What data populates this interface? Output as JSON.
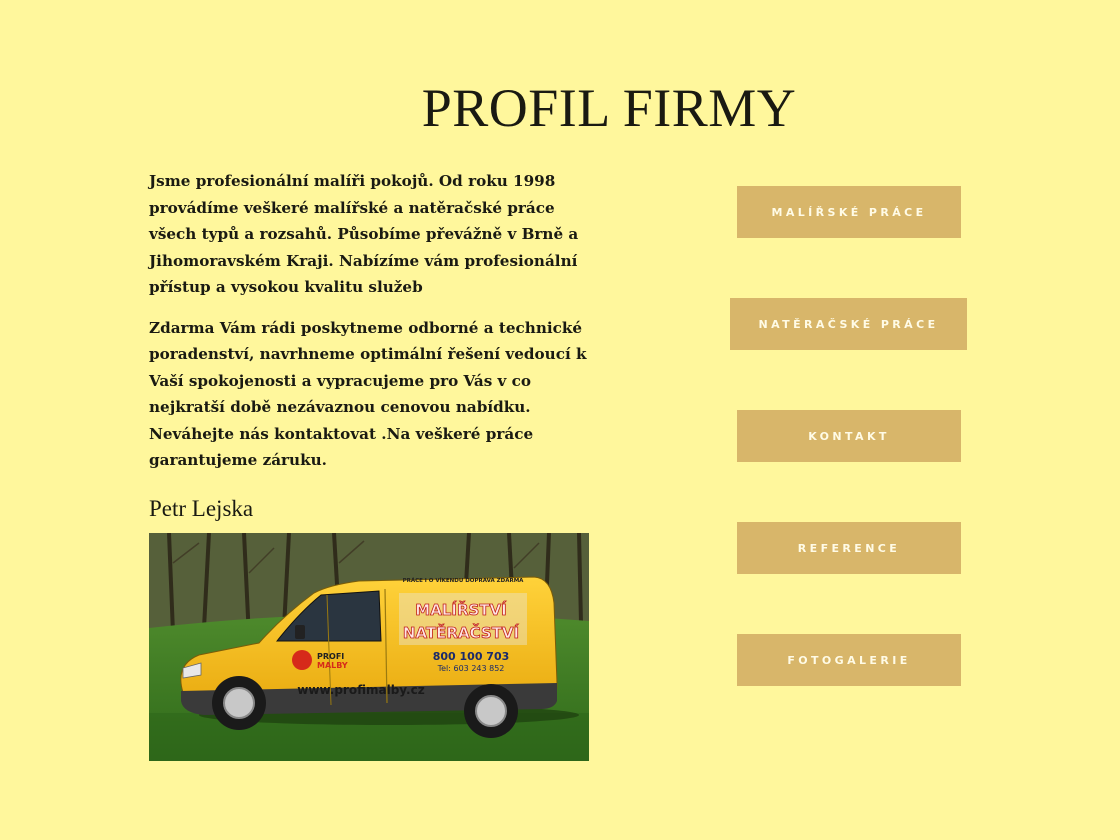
{
  "page": {
    "title": "PROFIL FIRMY"
  },
  "intro": {
    "paragraph1": "Jsme profesionální malíři pokojů. Od roku 1998 provádíme veškeré malířské a natěračské práce všech typů a rozsahů.  Působíme převážně v Brně a Jihomoravském Kraji.  Nabízíme vám profesionální přístup a vysokou kvalitu služeb",
    "paragraph2": "Zdarma Vám rádi poskytneme odborné a technické poradenství, navrhneme optimální řešení vedoucí k Vaší spokojenosti a vypracujeme pro Vás v co nejkratší době nezávaznou cenovou nabídku.  Neváhejte nás kontaktovat .Na veškeré práce garantujeme záruku.",
    "signature": "Petr Lejska"
  },
  "photo": {
    "van_top_text": "PRÁCE I O VÍKENDU DOPRAVA ZDARMA",
    "van_line1": "MALÍŘSTVÍ",
    "van_line2": "NATĚRAČSTVÍ",
    "van_phone": "800 100 703",
    "van_tel": "Tel: 603 243 852",
    "van_logo1": "PROFI",
    "van_logo2": "MALBY",
    "van_url": "www.profimalby.cz"
  },
  "nav": {
    "malirske": "MALÍŘSKÉ PRÁCE",
    "nateracske": "NATĚRAČSKÉ PRÁCE",
    "kontakt": "KONTAKT",
    "reference": "REFERENCE",
    "fotogalerie": "FOTOGALERIE"
  },
  "colors": {
    "background": "#fff79c",
    "button": "#d8b66a",
    "button_text": "#fffbe6",
    "van": "#f5c21b"
  }
}
